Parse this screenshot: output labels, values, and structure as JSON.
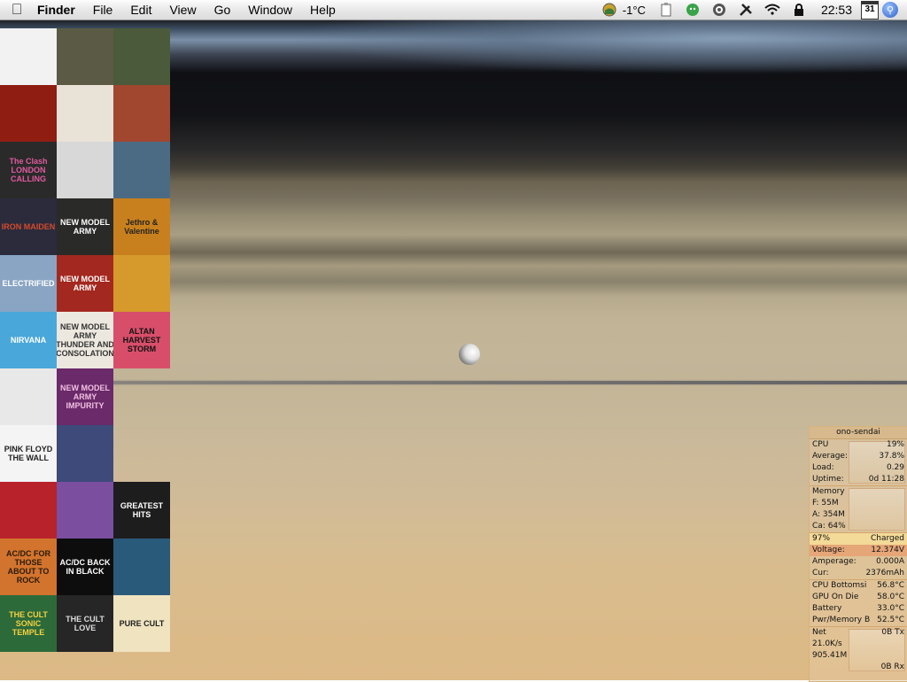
{
  "menubar": {
    "app_name": "Finder",
    "menus": [
      "File",
      "Edit",
      "View",
      "Go",
      "Window",
      "Help"
    ],
    "weather_temp": "-1°C",
    "clock": "22:53",
    "calendar_day": "31"
  },
  "albums": [
    {
      "text": "",
      "bg": "#f2f2f2",
      "fg": "#222"
    },
    {
      "text": "",
      "bg": "#5b5a44",
      "fg": "#fff"
    },
    {
      "text": "",
      "bg": "#4a5a3a",
      "fg": "#fff"
    },
    {
      "text": "",
      "bg": "#8f1d12",
      "fg": "#fff"
    },
    {
      "text": "",
      "bg": "#e9e3d7",
      "fg": "#222"
    },
    {
      "text": "",
      "bg": "#a1462f",
      "fg": "#fff"
    },
    {
      "text": "The Clash LONDON CALLING",
      "bg": "#2a2a2a",
      "fg": "#e05aa0"
    },
    {
      "text": "",
      "bg": "#d8d8d8",
      "fg": "#111"
    },
    {
      "text": "",
      "bg": "#4b6b84",
      "fg": "#fff"
    },
    {
      "text": "IRON MAIDEN",
      "bg": "#2b2b3c",
      "fg": "#d64a2a"
    },
    {
      "text": "NEW MODEL ARMY",
      "bg": "#2a2a28",
      "fg": "#ffffff"
    },
    {
      "text": "Jethro & Valentine",
      "bg": "#c8801e",
      "fg": "#222"
    },
    {
      "text": "ELECTRIFIED",
      "bg": "#8aa4c4",
      "fg": "#fff"
    },
    {
      "text": "NEW MODEL ARMY",
      "bg": "#a3281f",
      "fg": "#fff"
    },
    {
      "text": "",
      "bg": "#d69a2c",
      "fg": "#222"
    },
    {
      "text": "NIRVANA",
      "bg": "#4aa7d9",
      "fg": "#fff"
    },
    {
      "text": "NEW MODEL ARMY THUNDER AND CONSOLATION",
      "bg": "#ede8df",
      "fg": "#333"
    },
    {
      "text": "ALTAN HARVEST STORM",
      "bg": "#d84e6a",
      "fg": "#111"
    },
    {
      "text": "",
      "bg": "#e8e8e8",
      "fg": "#111"
    },
    {
      "text": "NEW MODEL ARMY IMPURITY",
      "bg": "#6b2a6a",
      "fg": "#f0c0e0"
    },
    {
      "text": "",
      "bg": "rgba(0,0,0,0)",
      "fg": "#fff"
    },
    {
      "text": "PINK FLOYD THE WALL",
      "bg": "#f4f4f4",
      "fg": "#222"
    },
    {
      "text": "",
      "bg": "#3d4a7a",
      "fg": "#fff"
    },
    {
      "text": "",
      "bg": "rgba(0,0,0,0)",
      "fg": "#fff"
    },
    {
      "text": "",
      "bg": "#b8232b",
      "fg": "#fff"
    },
    {
      "text": "",
      "bg": "#7c4ea0",
      "fg": "#fff"
    },
    {
      "text": "GREATEST HITS",
      "bg": "#1d1d1d",
      "fg": "#fff"
    },
    {
      "text": "AC/DC FOR THOSE ABOUT TO ROCK",
      "bg": "#d2742e",
      "fg": "#2a1a0a"
    },
    {
      "text": "AC/DC BACK IN BLACK",
      "bg": "#0d0d0d",
      "fg": "#ffffff"
    },
    {
      "text": "",
      "bg": "#2a5a7a",
      "fg": "#fff"
    },
    {
      "text": "THE CULT SONIC TEMPLE",
      "bg": "#2c6a3a",
      "fg": "#f5d040"
    },
    {
      "text": "THE CULT LOVE",
      "bg": "#262626",
      "fg": "#ddd"
    },
    {
      "text": "PURE CULT",
      "bg": "#efe3c0",
      "fg": "#222"
    }
  ],
  "monitor": {
    "host": "ono-sendai",
    "cpu": {
      "label": "CPU",
      "value": "19%"
    },
    "average": {
      "label": "Average:",
      "value": "37.8%"
    },
    "load": {
      "label": "Load:",
      "value": "0.29"
    },
    "uptime": {
      "label": "Uptime:",
      "value": "0d 11:28"
    },
    "memory": {
      "label": "Memory",
      "free": "F: 55M",
      "active": "A: 354M",
      "cache": "Ca: 64%"
    },
    "battery": {
      "percent": "97%",
      "status": "Charged"
    },
    "voltage": {
      "label": "Voltage:",
      "value": "12.374V"
    },
    "amperage": {
      "label": "Amperage:",
      "value": "0.000A"
    },
    "current": {
      "label": "Cur:",
      "value": "2376mAh"
    },
    "temps": [
      {
        "label": "CPU Bottomsi",
        "value": "56.8°C"
      },
      {
        "label": "GPU On Die",
        "value": "58.0°C"
      },
      {
        "label": "Battery",
        "value": "33.0°C"
      },
      {
        "label": "Pwr/Memory B",
        "value": "52.5°C"
      }
    ],
    "net": {
      "label": "Net",
      "tx": "0B Tx",
      "rate": "21.0K/s",
      "total": "905.41M",
      "rx": "0B Rx"
    }
  }
}
